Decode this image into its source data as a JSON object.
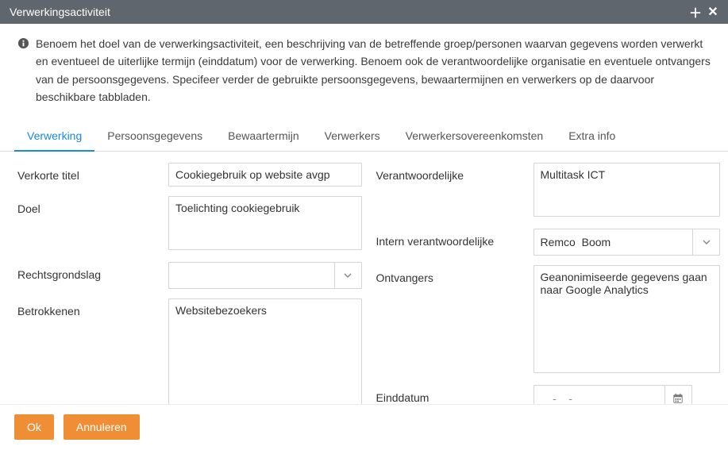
{
  "window": {
    "title": "Verwerkingsactiviteit"
  },
  "info": {
    "text": "Benoem het doel van de verwerkingsactiviteit, een beschrijving van de betreffende groep/personen waarvan gegevens worden verwerkt en eventueel de uiterlijke termijn (einddatum) voor de verwerking. Benoem ook de verantwoordelijke organisatie en eventuele ontvangers van de persoonsgegevens. Specifeer verder de gebruikte persoonsgegevens, bewaartermijnen en verwerkers op de daarvoor beschikbare tabbladen."
  },
  "tabs": [
    {
      "label": "Verwerking",
      "active": true
    },
    {
      "label": "Persoonsgegevens",
      "active": false
    },
    {
      "label": "Bewaartermijn",
      "active": false
    },
    {
      "label": "Verwerkers",
      "active": false
    },
    {
      "label": "Verwerkersovereenkomsten",
      "active": false
    },
    {
      "label": "Extra info",
      "active": false
    }
  ],
  "fields": {
    "verkorte_titel": {
      "label": "Verkorte titel",
      "value": "Cookiegebruik op website avgp"
    },
    "doel": {
      "label": "Doel",
      "value": "Toelichting cookiegebruik"
    },
    "rechtsgrondslag": {
      "label": "Rechtsgrondslag",
      "value": ""
    },
    "betrokkenen": {
      "label": "Betrokkenen",
      "value": "Websitebezoekers"
    },
    "verantwoordelijke": {
      "label": "Verantwoordelijke",
      "value": "Multitask ICT"
    },
    "intern_verantwoordelijke": {
      "label": "Intern verantwoordelijke",
      "value": "Remco  Boom"
    },
    "ontvangers": {
      "label": "Ontvangers",
      "value": "Geanonimiseerde gegevens gaan naar Google Analytics"
    },
    "einddatum": {
      "label": "Einddatum",
      "placeholder": "__-__-____"
    }
  },
  "buttons": {
    "ok": "Ok",
    "cancel": "Annuleren"
  }
}
